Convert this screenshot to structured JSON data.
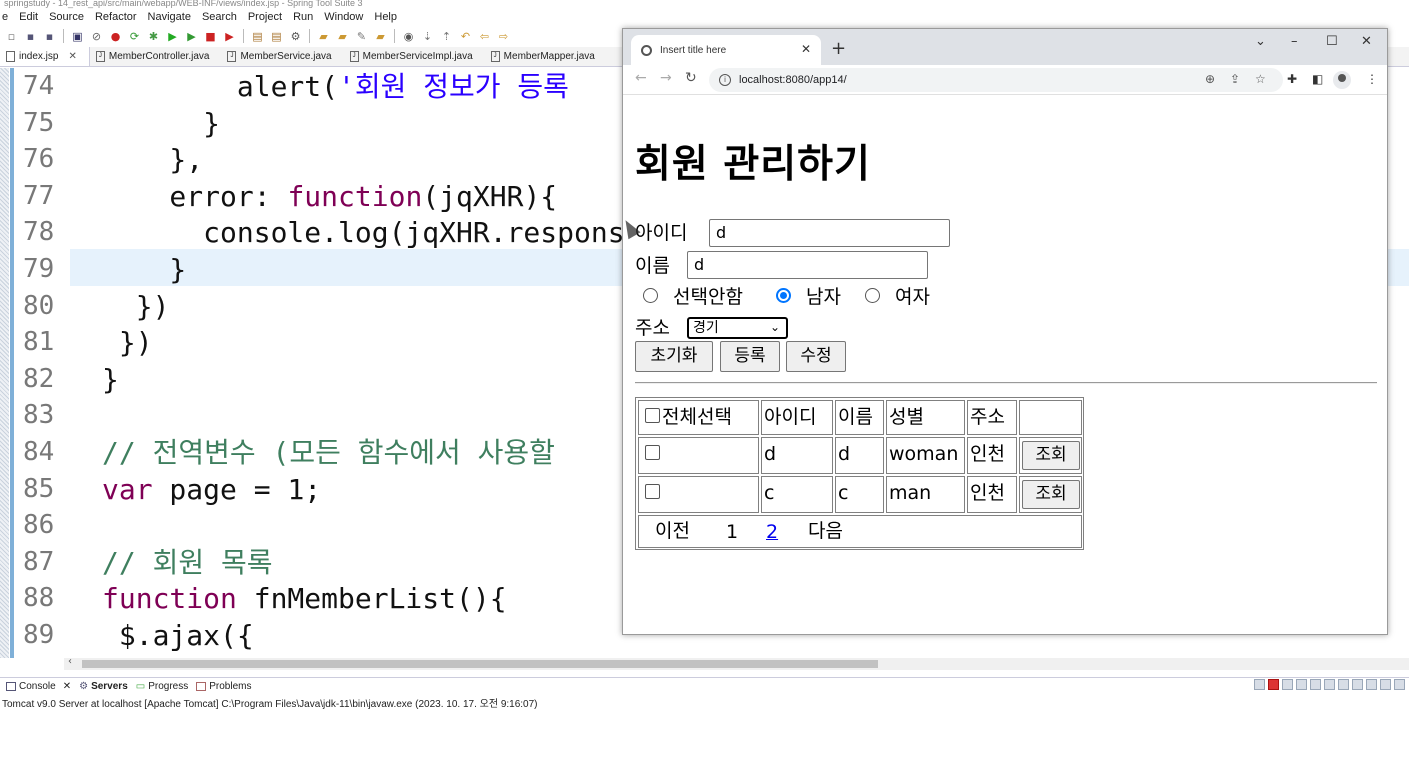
{
  "eclipse": {
    "title": "springstudy - 14_rest_api/src/main/webapp/WEB-INF/views/index.jsp - Spring Tool Suite 3",
    "menu": [
      "e",
      "Edit",
      "Source",
      "Refactor",
      "Navigate",
      "Search",
      "Project",
      "Run",
      "Window",
      "Help"
    ],
    "editor_tabs": [
      {
        "label": "index.jsp",
        "active": true
      },
      {
        "label": "MemberController.java"
      },
      {
        "label": "MemberService.java"
      },
      {
        "label": "MemberServiceImpl.java"
      },
      {
        "label": "MemberMapper.java"
      }
    ],
    "code_lines": [
      {
        "ln": "74",
        "html": "        alert(<span class=\"str\">'회원 정보가 등록</span>"
      },
      {
        "ln": "75",
        "html": "      }"
      },
      {
        "ln": "76",
        "html": "    },"
      },
      {
        "ln": "77",
        "html": "    error: <span class=\"kw\">function</span>(jqXHR){"
      },
      {
        "ln": "78",
        "html": "      console.log(jqXHR.respons"
      },
      {
        "ln": "79",
        "html": "    }"
      },
      {
        "ln": "80",
        "html": "  })"
      },
      {
        "ln": "81",
        "html": " })"
      },
      {
        "ln": "82",
        "html": "}"
      },
      {
        "ln": "83",
        "html": ""
      },
      {
        "ln": "84",
        "html": "<span class=\"cm\">// 전역변수 (모든 함수에서 사용할</span>"
      },
      {
        "ln": "85",
        "html": "<span class=\"kw\">var</span> page = 1;"
      },
      {
        "ln": "86",
        "html": ""
      },
      {
        "ln": "87",
        "html": "<span class=\"cm\">// 회원 목록</span>"
      },
      {
        "ln": "88",
        "html": "<span class=\"kw\">function</span> fnMemberList(){"
      },
      {
        "ln": "89",
        "html": " $.ajax({"
      }
    ],
    "console_tabs": {
      "console": "Console",
      "servers": "Servers",
      "progress": "Progress",
      "problems": "Problems"
    },
    "console_desc": "Tomcat v9.0 Server at localhost [Apache Tomcat] C:\\Program Files\\Java\\jdk-11\\bin\\javaw.exe  (2023. 10. 17. 오전 9:16:07)"
  },
  "browser": {
    "tab_title": "Insert title here",
    "url": "localhost:8080/app14/",
    "page": {
      "title": "회원 관리하기",
      "id_label": "아이디",
      "id_value": "d",
      "name_label": "이름",
      "name_value": "d",
      "gender_options": [
        "선택안함",
        "남자",
        "여자"
      ],
      "gender_selected": 1,
      "address_label": "주소",
      "address_value": "경기",
      "buttons": {
        "reset": "초기화",
        "register": "등록",
        "modify": "수정"
      },
      "table": {
        "headers": [
          "전체선택",
          "아이디",
          "이름",
          "성별",
          "주소",
          ""
        ],
        "rows": [
          {
            "id": "d",
            "name": "d",
            "gender": "woman",
            "address": "인천",
            "action": "조회"
          },
          {
            "id": "c",
            "name": "c",
            "gender": "man",
            "address": "인천",
            "action": "조회"
          }
        ],
        "pager": {
          "prev": "이전",
          "page1": "1",
          "page2": "2",
          "next": "다음"
        }
      }
    }
  }
}
